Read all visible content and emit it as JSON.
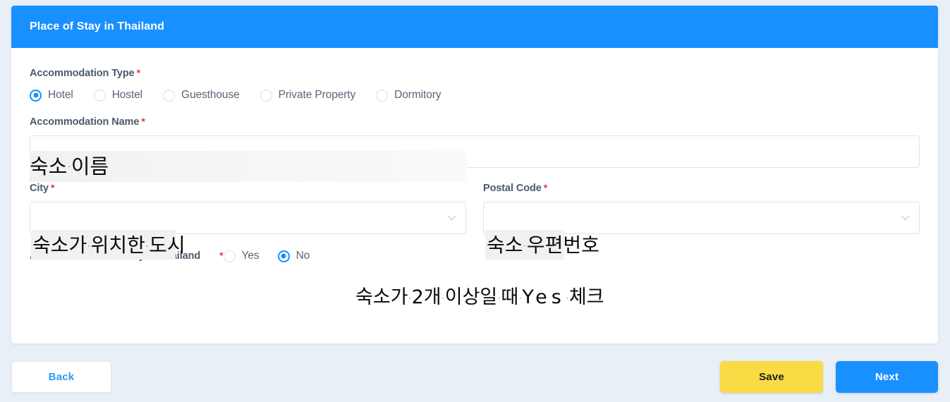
{
  "colors": {
    "header_blue": "#1890ff",
    "page_background": "#e9eff7",
    "required_red": "#e8353d",
    "save_yellow": "#f9db45",
    "next_blue": "#1890ff",
    "back_text_blue": "#2e9bf4",
    "label_gray": "#4c5a6b",
    "input_border": "#dfe3e8"
  },
  "card": {
    "header": {
      "title": "Place of Stay in Thailand"
    }
  },
  "form": {
    "accommodation_type": {
      "label": "Accommodation Type",
      "required_mark": "*",
      "options": [
        {
          "label": "Hotel",
          "selected": true
        },
        {
          "label": "Hostel",
          "selected": false
        },
        {
          "label": "Guesthouse",
          "selected": false
        },
        {
          "label": "Private Property",
          "selected": false
        },
        {
          "label": "Dormitory",
          "selected": false
        }
      ]
    },
    "accommodation_name": {
      "label": "Accommodation Name",
      "required_mark": "*",
      "value": "",
      "placeholder": ""
    },
    "city": {
      "label": "City",
      "required_mark": "*",
      "value": "",
      "placeholder": "",
      "chevron_icon": "chevron-down-icon"
    },
    "postal_code": {
      "label": "Postal Code",
      "required_mark": "*",
      "value": "",
      "placeholder": "",
      "chevron_icon": "chevron-down-icon"
    },
    "additional_place_of_stay": {
      "label": "Additional Place of Stay in Thailand",
      "required_mark": "*",
      "options": [
        {
          "label": "Yes",
          "selected": false
        },
        {
          "label": "No",
          "selected": true
        }
      ]
    }
  },
  "annotations": {
    "accommodation_name": {
      "part1": "숙소",
      "part2": "이름"
    },
    "city": {
      "part1": "숙소가",
      "part2": "위치한",
      "part3": "도시"
    },
    "postal_code": {
      "part1": "숙소",
      "part2": "우편번호"
    },
    "additional": {
      "part1": "숙소가",
      "part2": "2개",
      "part3": "이상일",
      "part4": "때",
      "part5": "Yes",
      "part6": "체크"
    }
  },
  "footer": {
    "back_label": "Back",
    "save_label": "Save",
    "next_label": "Next"
  }
}
